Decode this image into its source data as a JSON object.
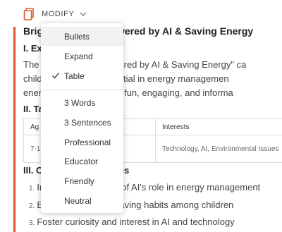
{
  "toolbar": {
    "modify_label": "MODIFY"
  },
  "document": {
    "title": "Bright Minds: Empowered by AI & Saving Energy",
    "section1_heading": "I. Ex",
    "paragraph_lines": [
      "The \"Bright Minds: Powered by AI & Saving Energy\" ca",
      "children about AI's potential in energy managemen",
      "energy saving through a fun, engaging, and informa"
    ],
    "section2_heading": "II. Ta",
    "table": {
      "headers": [
        "Ag",
        "Interests"
      ],
      "row": {
        "age": "7-12",
        "interests": "Technology, AI, Environmental Issues"
      }
    },
    "section3_heading": "III. Campaign Objectives",
    "objectives": [
      {
        "num": "1.",
        "text": "Increase awareness of AI's role in energy management"
      },
      {
        "num": "2.",
        "text": "Encourage energy-saving habits among children"
      },
      {
        "num": "3.",
        "text": "Foster curiosity and interest in AI and technology"
      }
    ]
  },
  "dropdown": {
    "items": [
      "Bullets",
      "Expand",
      "Table",
      "3 Words",
      "3 Sentences",
      "Professional",
      "Educator",
      "Friendly",
      "Neutral"
    ],
    "selected": "Table",
    "hovered": "Bullets"
  },
  "colors": {
    "accent": "#e0552a"
  }
}
